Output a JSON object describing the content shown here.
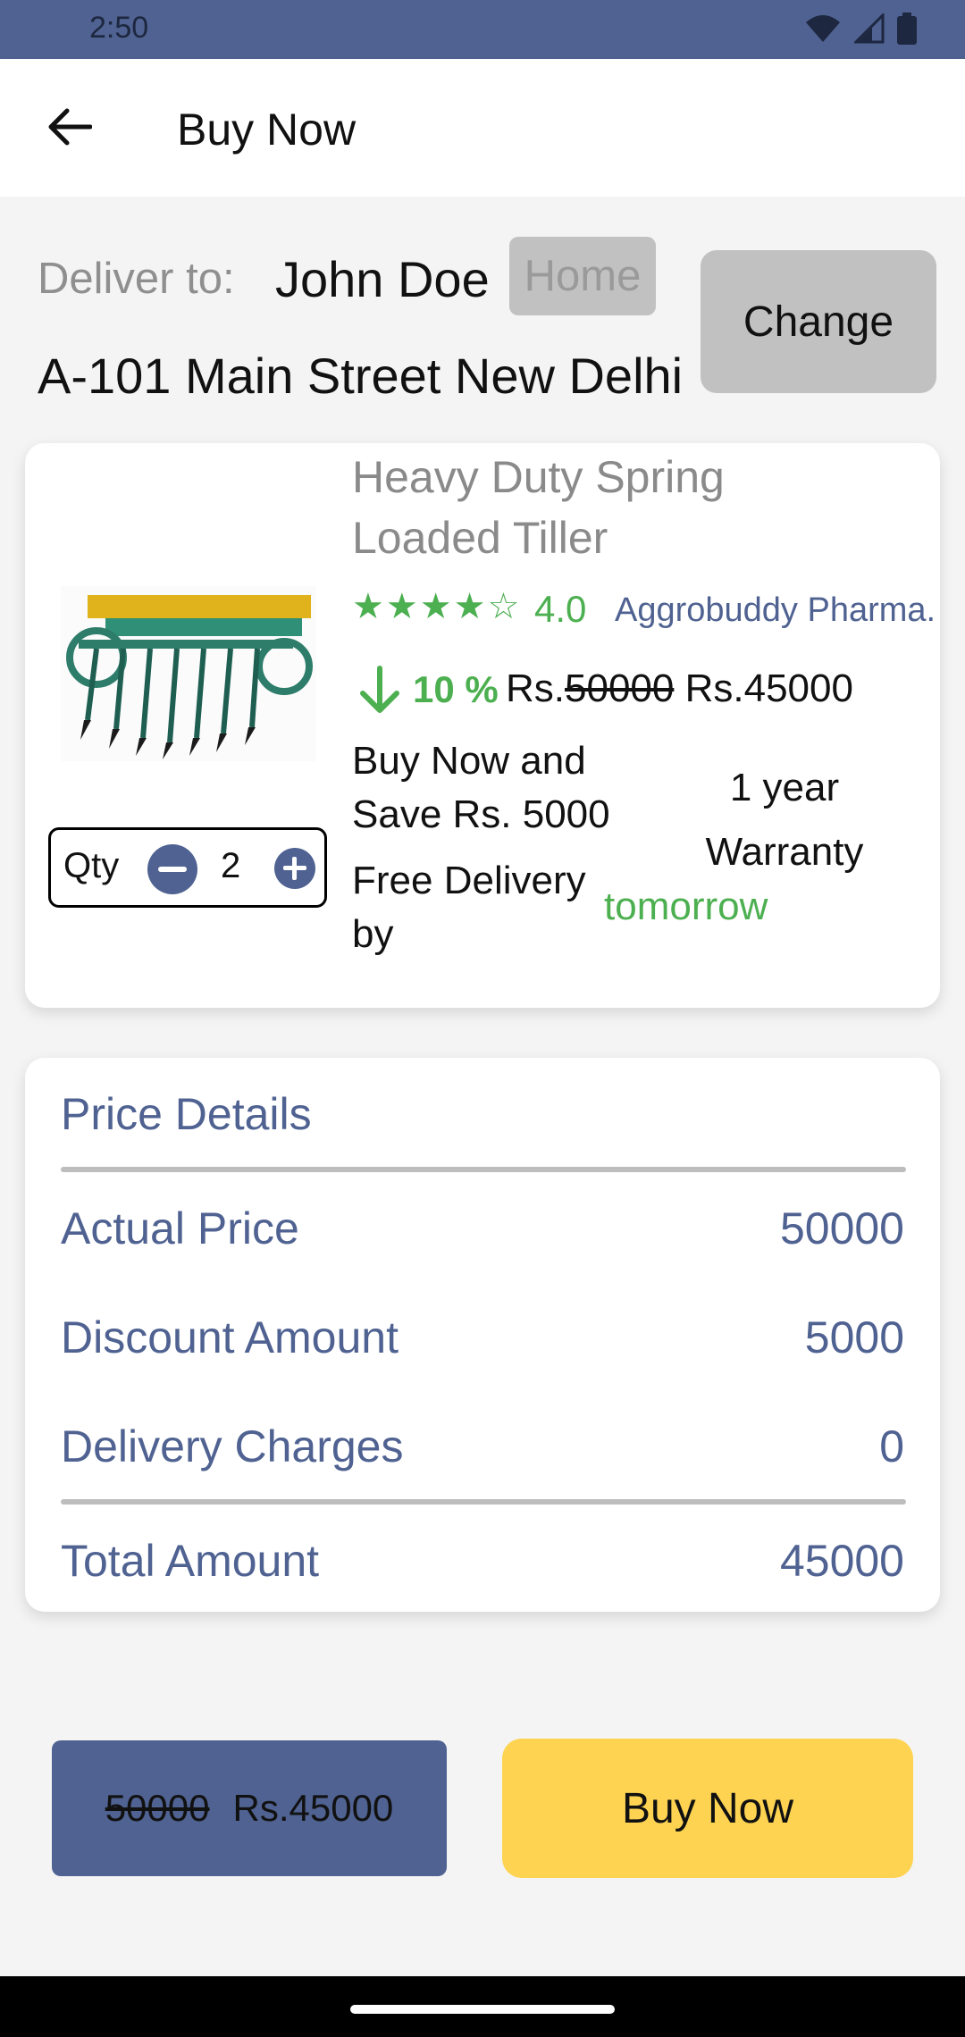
{
  "status_bar": {
    "time": "2:50"
  },
  "app_bar": {
    "title": "Buy Now"
  },
  "delivery": {
    "label": "Deliver to:",
    "name": "John Doe",
    "address_type": "Home",
    "address": "A-101 Main Street New Delhi",
    "change_label": "Change"
  },
  "product": {
    "name": "Heavy Duty Spring Loaded Tiller",
    "stars": "★★★★☆",
    "rating": "4.0",
    "seller": "Aggrobuddy Pharma.",
    "discount": "10 %",
    "price_prefix": "Rs.",
    "original_price": "50000",
    "final_price": "Rs.45000",
    "offer": "Buy Now and Save Rs. 5000",
    "warranty": "1 year Warranty",
    "delivery_text": "Free Delivery by",
    "delivery_day": "tomorrow",
    "qty_label": "Qty",
    "qty": "2"
  },
  "price_details": {
    "title": "Price Details",
    "rows": [
      {
        "label": "Actual Price",
        "value": "50000"
      },
      {
        "label": "Discount Amount",
        "value": "5000"
      },
      {
        "label": "Delivery Charges",
        "value": "0"
      }
    ],
    "total_label": "Total Amount",
    "total_value": "45000"
  },
  "bottom": {
    "original": "50000",
    "final": "Rs.45000",
    "buy_label": "Buy Now"
  },
  "colors": {
    "primary": "#4f6291",
    "accent_green": "#4caf50",
    "buy_button": "#fdd351",
    "badge_gray": "#c1c1c1"
  }
}
